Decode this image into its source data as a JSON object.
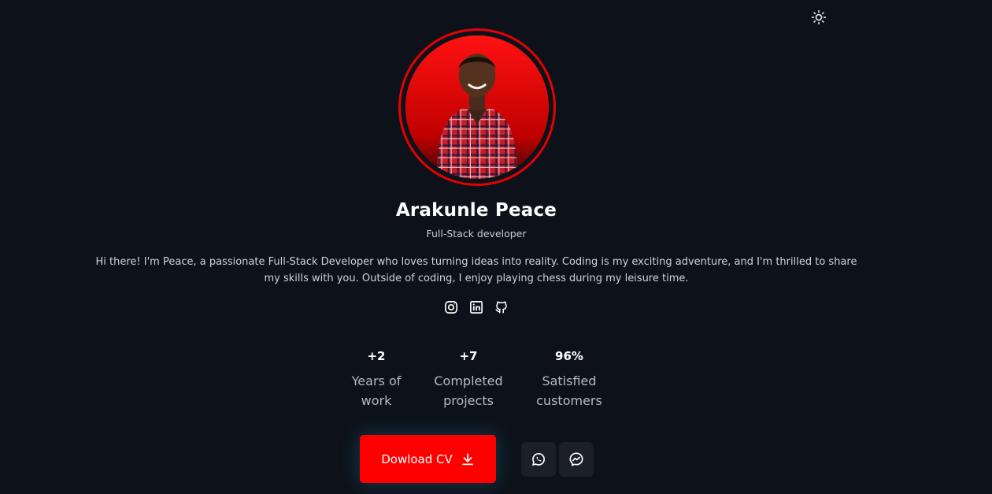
{
  "profile": {
    "name": "Arakunle Peace",
    "role": "Full-Stack developer",
    "bio": "Hi there! I'm Peace, a passionate Full-Stack Developer who loves turning ideas into reality. Coding is my exciting adventure, and I'm thrilled to share my skills with you. Outside of coding, I enjoy playing chess during my leisure time."
  },
  "icons": {
    "theme_toggle": "sun-icon",
    "socials": [
      "instagram-icon",
      "linkedin-icon",
      "github-icon"
    ],
    "download": "download-icon",
    "contacts": [
      "whatsapp-icon",
      "messenger-icon"
    ]
  },
  "stats": [
    {
      "value": "+2",
      "label_1": "Years of",
      "label_2": "work"
    },
    {
      "value": "+7",
      "label_1": "Completed",
      "label_2": "projects"
    },
    {
      "value": "96%",
      "label_1": "Satisfied",
      "label_2": "customers"
    }
  ],
  "actions": {
    "download_label": "Dowload CV"
  },
  "colors": {
    "background": "#0d121a",
    "accent": "#ff0000",
    "contact_button_bg": "#1b2028"
  }
}
